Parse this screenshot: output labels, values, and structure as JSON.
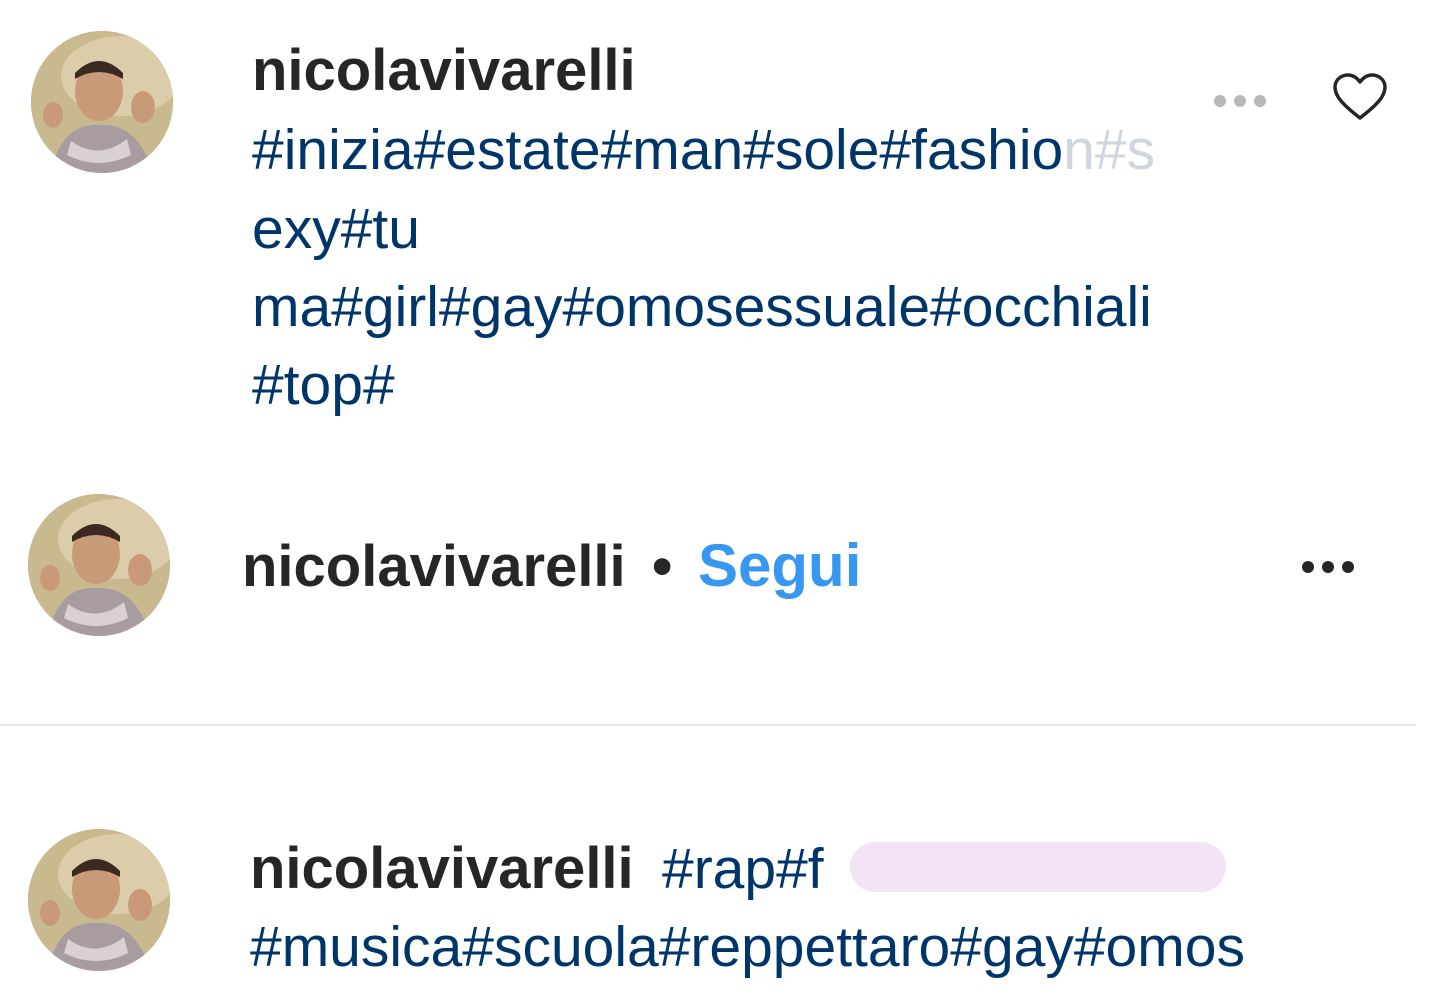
{
  "comment_1": {
    "username": "nicolavivarelli",
    "caption_lines": [
      {
        "main": "#inizia#estate#man#sole#fashio",
        "faded": "n#s"
      },
      {
        "main": "exy#tu",
        "faded": ""
      },
      {
        "main": "ma#girl#gay#omosessuale#occhiali",
        "faded": ""
      },
      {
        "main": "#top#",
        "faded": ""
      }
    ],
    "options_icon": "more-horizontal-icon",
    "like_icon": "heart-outline-icon"
  },
  "post_header": {
    "username": "nicolavivarelli",
    "separator": "•",
    "follow_label": "Segui",
    "options_icon": "more-horizontal-icon"
  },
  "comment_2": {
    "username": "nicolavivarelli",
    "caption_line_1": "#rap#f",
    "caption_line_2": "#musica#scuola#reppettaro#gay#omos",
    "redaction_color": "#f2e3f5"
  },
  "colors": {
    "hashtag": "#003569",
    "follow": "#3897f0",
    "text": "#262626",
    "divider": "#e6e6e6"
  }
}
